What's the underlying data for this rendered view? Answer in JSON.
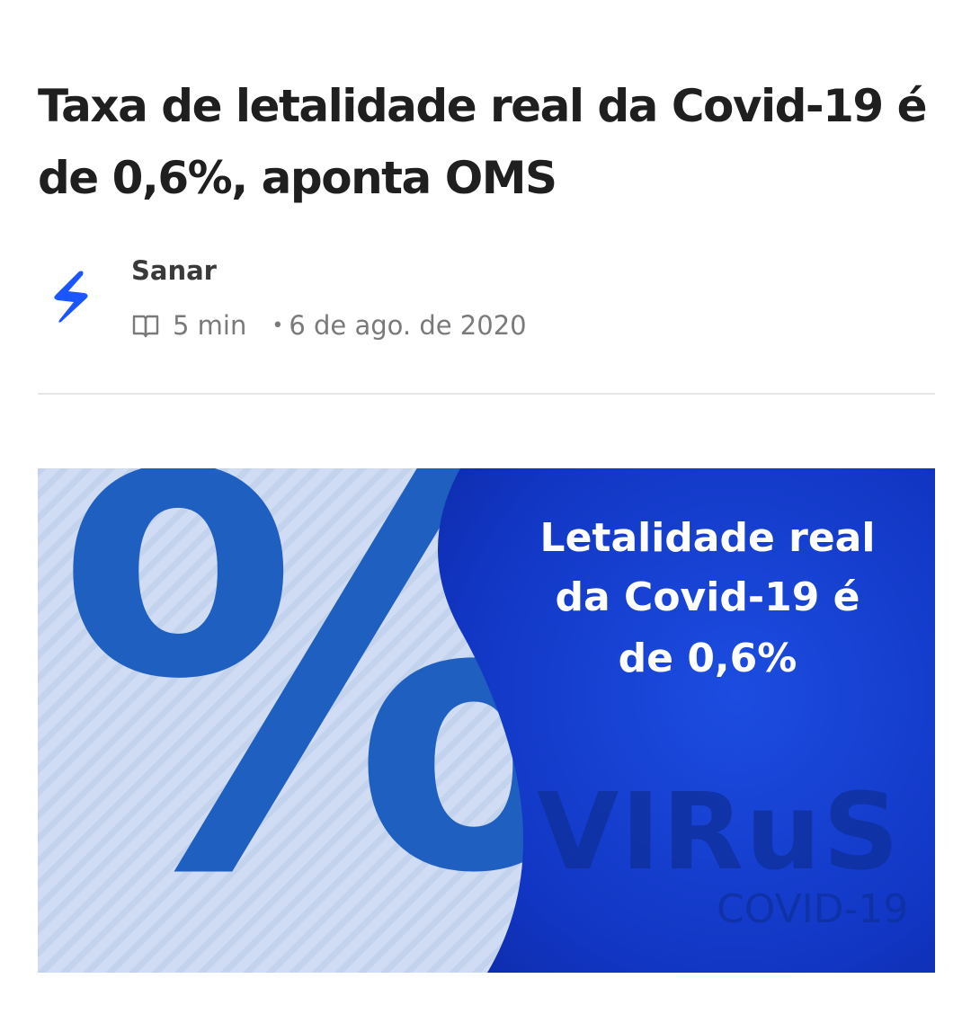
{
  "article": {
    "title": "Taxa de letalidade real da Covid-19 é de 0,6%, aponta OMS",
    "author": "Sanar",
    "read_time": "5 min",
    "date": "6 de ago. de 2020",
    "separator": "•"
  },
  "cover_image": {
    "percent_symbol": "%",
    "headline_lines": [
      "Letalidade real",
      "da Covid-19 é",
      "de 0,6%"
    ],
    "watermark_word": "VIRuS",
    "watermark_sub": "COVID-19"
  },
  "icons": {
    "logo": "sanar-logo-icon",
    "read_time": "book-open-icon"
  },
  "colors": {
    "logo_blue": "#1a56ff",
    "percent_blue": "#1f5fbf",
    "panel_blue": "#1239c9",
    "light_bg": "#cfdcf3"
  }
}
